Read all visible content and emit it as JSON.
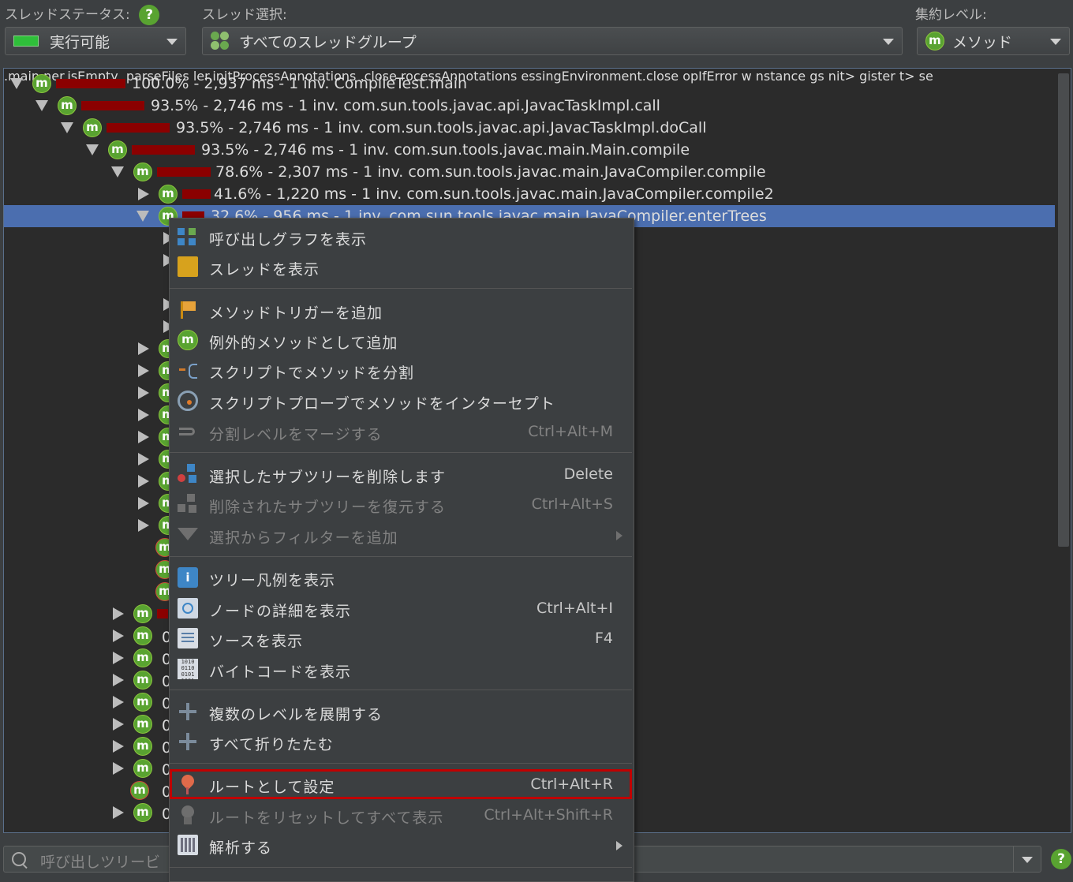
{
  "toolbar": {
    "thread_status_label": "スレッドステータス:",
    "thread_status_value": "実行可能",
    "thread_select_label": "スレッド選択:",
    "thread_select_value": "すべてのスレッドグループ",
    "aggregation_label": "集約レベル:",
    "aggregation_value": "メソッド",
    "help_glyph": "?"
  },
  "icons": {
    "method_glyph": "m",
    "info_glyph": "i",
    "bytecode_glyph": "1010 0110 0101 1001"
  },
  "tree": {
    "rows": [
      {
        "label": "100.0% - 2,937 ms - 1 inv. CompileTest.main"
      },
      {
        "label": "93.5% - 2,746 ms - 1 inv. com.sun.tools.javac.api.JavacTaskImpl.call"
      },
      {
        "label": "93.5% - 2,746 ms - 1 inv. com.sun.tools.javac.api.JavacTaskImpl.doCall"
      },
      {
        "label": "93.5% - 2,746 ms - 1 inv. com.sun.tools.javac.main.Main.compile"
      },
      {
        "label": "78.6% - 2,307 ms - 1 inv. com.sun.tools.javac.main.JavaCompiler.compile"
      },
      {
        "label": "41.6% - 1,220 ms - 1 inv. com.sun.tools.javac.main.JavaCompiler.compile2"
      },
      {
        "label": "32.6% - 956 ms - 1 inv. com.sun.tools.javac.main.JavaCompiler.enterTrees"
      }
    ],
    "fragments": [
      ".main",
      "ner.isEmpty",
      ".parseFiles",
      "ler.initProcessAnnotations",
      ".close",
      "rocessAnnotations",
      "essingEnvironment.close",
      "opIfError",
      "w",
      "nstance",
      "gs",
      "nit>",
      "gister",
      "t>",
      "se"
    ],
    "zero_prefix": "0"
  },
  "context_menu": {
    "items": [
      {
        "label": "呼び出しグラフを表示",
        "shortcut": ""
      },
      {
        "label": "スレッドを表示",
        "shortcut": ""
      },
      {
        "label": "メソッドトリガーを追加",
        "shortcut": ""
      },
      {
        "label": "例外的メソッドとして追加",
        "shortcut": ""
      },
      {
        "label": "スクリプトでメソッドを分割",
        "shortcut": ""
      },
      {
        "label": "スクリプトプローブでメソッドをインターセプト",
        "shortcut": ""
      },
      {
        "label": "分割レベルをマージする",
        "shortcut": "Ctrl+Alt+M"
      },
      {
        "label": "選択したサブツリーを削除します",
        "shortcut": "Delete"
      },
      {
        "label": "削除されたサブツリーを復元する",
        "shortcut": "Ctrl+Alt+S"
      },
      {
        "label": "選択からフィルターを追加",
        "shortcut": ""
      },
      {
        "label": "ツリー凡例を表示",
        "shortcut": ""
      },
      {
        "label": "ノードの詳細を表示",
        "shortcut": "Ctrl+Alt+I"
      },
      {
        "label": "ソースを表示",
        "shortcut": "F4"
      },
      {
        "label": "バイトコードを表示",
        "shortcut": ""
      },
      {
        "label": "複数のレベルを展開する",
        "shortcut": ""
      },
      {
        "label": "すべて折りたたむ",
        "shortcut": ""
      },
      {
        "label": "ルートとして設定",
        "shortcut": "Ctrl+Alt+R"
      },
      {
        "label": "ルートをリセットしてすべて表示",
        "shortcut": "Ctrl+Alt+Shift+R"
      },
      {
        "label": "解析する",
        "shortcut": ""
      }
    ]
  },
  "search": {
    "placeholder": "呼び出しツリービ"
  },
  "colors": {
    "selection": "#4b6eaf",
    "bar": "#8b0000",
    "highlight_outline": "#c00000",
    "method_icon": "#59a331"
  }
}
